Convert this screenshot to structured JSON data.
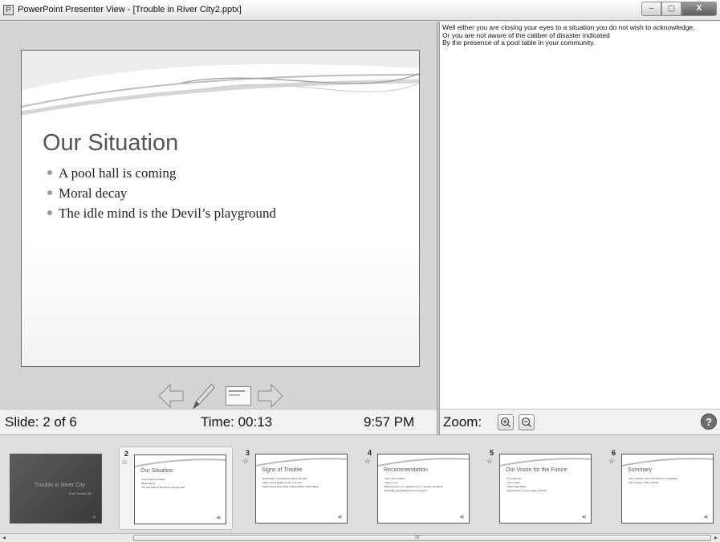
{
  "window": {
    "title": "PowerPoint Presenter View - [Trouble in River City2.pptx]",
    "buttons": [
      "–",
      "▢",
      "X"
    ]
  },
  "current_slide": {
    "title": "Our Situation",
    "bullets": [
      "A pool hall is coming",
      "Moral decay",
      "The idle mind is the Devil’s playground"
    ]
  },
  "status": {
    "slide": "Slide: 2 of 6",
    "time": "Time: 00:13",
    "clock": "9:57 PM",
    "zoom_label": "Zoom:",
    "help": "?"
  },
  "notes": [
    "Well either you are closing your eyes to a situation you do not wish to acknowledge,",
    "Or you are not aware of the caliber of disaster indicated",
    "By the presence of a pool table in your community."
  ],
  "thumbnails": [
    {
      "num": "",
      "title": "Trouble in River City",
      "subtitle": "Prof. Harold Hill",
      "bullets": [],
      "dark": true
    },
    {
      "num": "2",
      "title": "Our Situation",
      "bullets": [
        "A pool hall is coming",
        "Moral decay",
        "The idle mind is the Devil’s playground"
      ],
      "dark": false
    },
    {
      "num": "3",
      "title": "Signs of Trouble",
      "bullets": [
        "Rebuilding of mudsherbs below the knee",
        "Dime novels hidden in the corn crib",
        "Memorizing jokes from Captain Billy’s Whiz Bang"
      ],
      "dark": false
    },
    {
      "num": "4",
      "title": "Recommendation",
      "bullets": [
        "Start a Boy’s Band",
        "Start it soon",
        "Billiard parlor no competition for a golden saxophone",
        "Remember the Mailed Voice of pelicho"
      ],
      "dark": false
    },
    {
      "num": "5",
      "title": "Our Vision for the Future",
      "bullets": [
        "76 trombones",
        "110 Cornets",
        "1000s Slide Flutes",
        "Tambourines of every shape and size"
      ],
      "dark": false
    },
    {
      "num": "6",
      "title": "Summary",
      "bullets": [
        "The problem: a Pool Table in our community",
        "The solution: a Boy’s Band"
      ],
      "dark": false
    }
  ],
  "scroll_grip": "III"
}
